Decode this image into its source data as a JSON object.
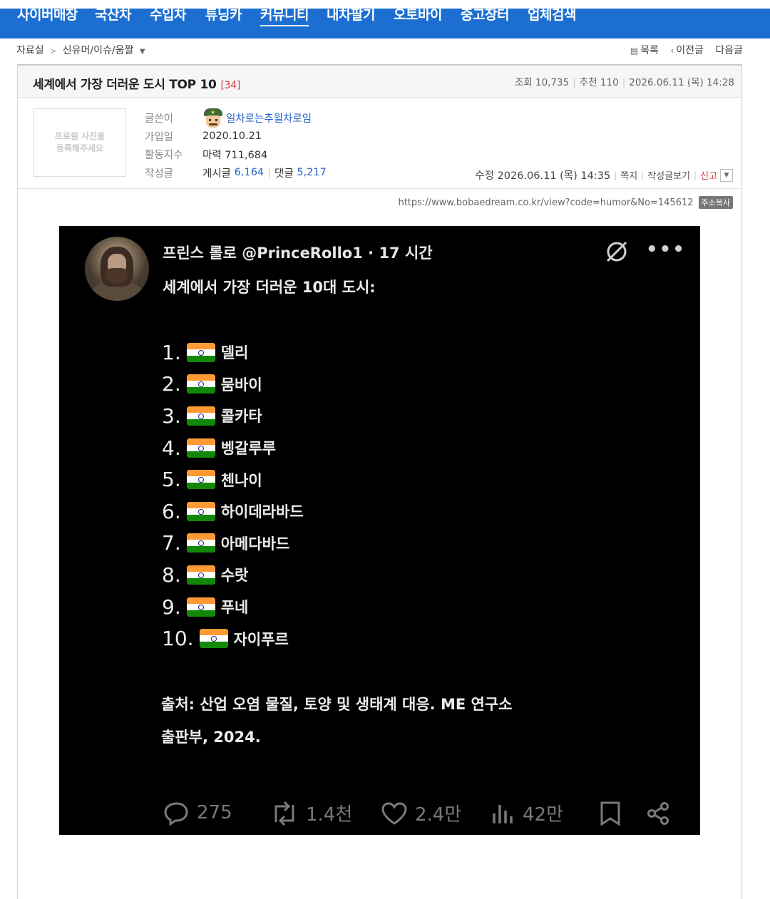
{
  "nav": {
    "items": [
      "사이버매장",
      "국산차",
      "수입차",
      "튜닝카",
      "커뮤니티",
      "내차팔기",
      "오토바이",
      "중고장터",
      "업체검색"
    ],
    "active_index": 4
  },
  "breadcrumb": {
    "root": "자료실",
    "separator": ">",
    "current": "신유머/이슈/움짤"
  },
  "post_nav": {
    "list": "목록",
    "prev": "이전글",
    "next": "다음글"
  },
  "post": {
    "title": "세계에서 가장 더러운 도시 TOP 10",
    "comment_count": "[34]",
    "views": "조회 10,735",
    "recommend": "추천 110",
    "date": "2026.06.11 (목) 14:28"
  },
  "author": {
    "profile_placeholder_line1": "프로필 사진을",
    "profile_placeholder_line2": "등록해주세요",
    "labels": {
      "writer": "글쓴이",
      "joined": "가입일",
      "activity": "활동지수",
      "posts": "작성글"
    },
    "nickname": "일차로는추월차로임",
    "joined": "2020.10.21",
    "activity": "마력 711,684",
    "posts_label": "게시글",
    "posts_count": "6,164",
    "comments_label": "댓글",
    "comments_count": "5,217"
  },
  "meta": {
    "modified": "수정 2026.06.11 (목) 14:35",
    "message": "쪽지",
    "view_posts": "작성글보기",
    "report": "신고"
  },
  "url": {
    "text": "https://www.bobaedream.co.kr/view?code=humor&No=145612",
    "copy_label": "주소복사"
  },
  "tweet": {
    "author": "프린스 롤로 @PrinceRollo1",
    "time": "· 17 시간",
    "heading": "세계에서 가장 더러운 10대 도시:",
    "list": [
      {
        "num": "1.",
        "city": "델리"
      },
      {
        "num": "2.",
        "city": "뭄바이"
      },
      {
        "num": "3.",
        "city": "콜카타"
      },
      {
        "num": "4.",
        "city": "벵갈루루"
      },
      {
        "num": "5.",
        "city": "첸나이"
      },
      {
        "num": "6.",
        "city": "하이데라바드"
      },
      {
        "num": "7.",
        "city": "아메다바드"
      },
      {
        "num": "8.",
        "city": "수랏"
      },
      {
        "num": "9.",
        "city": "푸네"
      },
      {
        "num": "10.",
        "city": "자이푸르"
      }
    ],
    "source_line1": "출처: 산업 오염 물질, 토양 및 생태계 대응. ME 연구소",
    "source_line2": "출판부, 2024.",
    "replies": "275",
    "reposts": "1.4천",
    "likes": "2.4만",
    "views": "42만"
  },
  "colors": {
    "nav_bg": "#1c6fd1",
    "link_blue": "#2a62c8",
    "accent_red": "#d23c3c",
    "tweet_bg": "#000000",
    "flag_saffron": "#ff9933",
    "flag_green": "#138808"
  }
}
